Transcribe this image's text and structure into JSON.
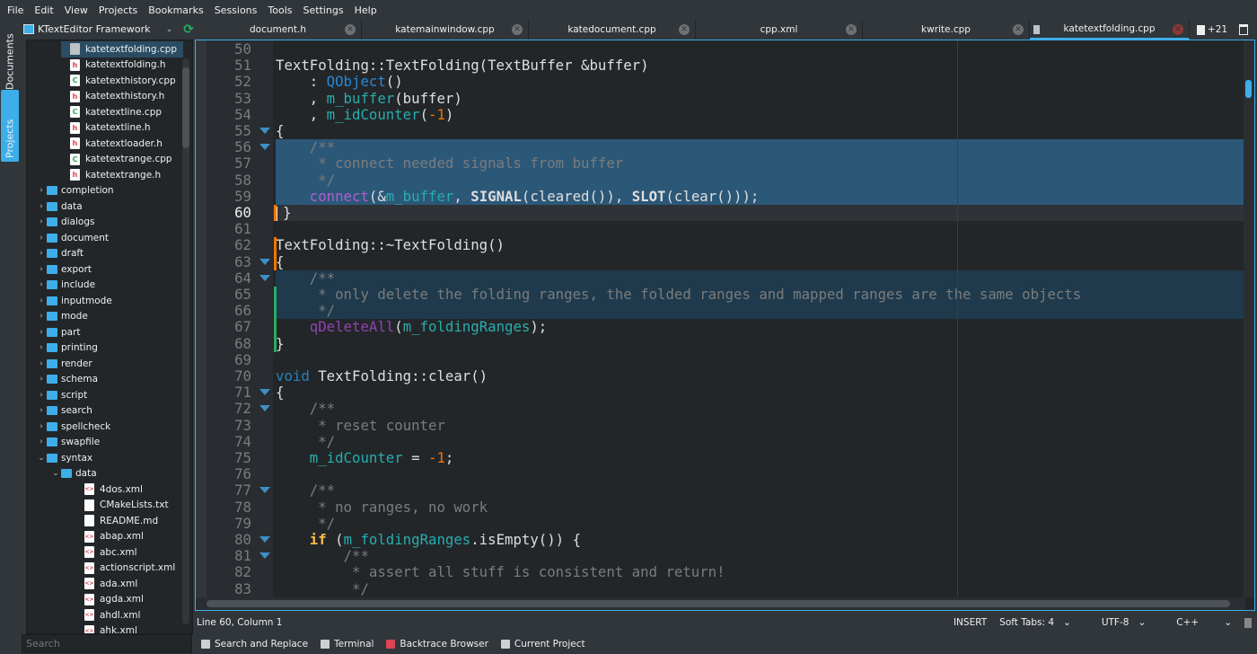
{
  "menu": [
    "File",
    "Edit",
    "View",
    "Projects",
    "Bookmarks",
    "Sessions",
    "Tools",
    "Settings",
    "Help"
  ],
  "left_tabs": {
    "documents": "Documents",
    "projects": "Projects"
  },
  "project": {
    "name": "KTextEditor Framework",
    "refresh_icon": "refresh-icon",
    "dropdown_icon": "chevron-down-icon"
  },
  "tree": [
    {
      "label": "katetextfolding.cpp",
      "type": "cpp-open",
      "level": 3,
      "selected": true
    },
    {
      "label": "katetextfolding.h",
      "type": "h",
      "level": 3
    },
    {
      "label": "katetexthistory.cpp",
      "type": "cpp",
      "level": 3
    },
    {
      "label": "katetexthistory.h",
      "type": "h",
      "level": 3
    },
    {
      "label": "katetextline.cpp",
      "type": "cpp",
      "level": 3
    },
    {
      "label": "katetextline.h",
      "type": "h",
      "level": 3
    },
    {
      "label": "katetextloader.h",
      "type": "h",
      "level": 3
    },
    {
      "label": "katetextrange.cpp",
      "type": "cpp",
      "level": 3
    },
    {
      "label": "katetextrange.h",
      "type": "h",
      "level": 3
    },
    {
      "label": "completion",
      "type": "dir",
      "level": 1
    },
    {
      "label": "data",
      "type": "dir",
      "level": 1
    },
    {
      "label": "dialogs",
      "type": "dir",
      "level": 1
    },
    {
      "label": "document",
      "type": "dir",
      "level": 1
    },
    {
      "label": "draft",
      "type": "dir",
      "level": 1
    },
    {
      "label": "export",
      "type": "dir",
      "level": 1
    },
    {
      "label": "include",
      "type": "dir",
      "level": 1
    },
    {
      "label": "inputmode",
      "type": "dir",
      "level": 1
    },
    {
      "label": "mode",
      "type": "dir",
      "level": 1
    },
    {
      "label": "part",
      "type": "dir",
      "level": 1
    },
    {
      "label": "printing",
      "type": "dir",
      "level": 1
    },
    {
      "label": "render",
      "type": "dir",
      "level": 1
    },
    {
      "label": "schema",
      "type": "dir",
      "level": 1
    },
    {
      "label": "script",
      "type": "dir",
      "level": 1
    },
    {
      "label": "search",
      "type": "dir",
      "level": 1
    },
    {
      "label": "spellcheck",
      "type": "dir",
      "level": 1
    },
    {
      "label": "swapfile",
      "type": "dir",
      "level": 1
    },
    {
      "label": "syntax",
      "type": "dir-open",
      "level": 1
    },
    {
      "label": "data",
      "type": "dir-open",
      "level": 2
    },
    {
      "label": "4dos.xml",
      "type": "xml",
      "level": 4
    },
    {
      "label": "CMakeLists.txt",
      "type": "txt",
      "level": 4
    },
    {
      "label": "README.md",
      "type": "txt",
      "level": 4
    },
    {
      "label": "abap.xml",
      "type": "xml",
      "level": 4
    },
    {
      "label": "abc.xml",
      "type": "xml",
      "level": 4
    },
    {
      "label": "actionscript.xml",
      "type": "xml",
      "level": 4
    },
    {
      "label": "ada.xml",
      "type": "xml",
      "level": 4
    },
    {
      "label": "agda.xml",
      "type": "xml",
      "level": 4
    },
    {
      "label": "ahdl.xml",
      "type": "xml",
      "level": 4
    },
    {
      "label": "ahk.xml",
      "type": "xml",
      "level": 4
    }
  ],
  "search_placeholder": "Search",
  "tabs": [
    {
      "label": "document.h"
    },
    {
      "label": "katemainwindow.cpp"
    },
    {
      "label": "katedocument.cpp"
    },
    {
      "label": "cpp.xml"
    },
    {
      "label": "kwrite.cpp"
    },
    {
      "label": "katetextfolding.cpp",
      "active": true
    }
  ],
  "more_tabs": "+21",
  "editor": {
    "first_line": 50,
    "current_line": 60,
    "selected_lines": [
      56,
      57,
      58,
      59
    ],
    "hover_fold_lines": [
      64,
      65,
      66
    ],
    "fold_markers": [
      55,
      56,
      63,
      64,
      71,
      72,
      77,
      80,
      81
    ],
    "modified_orange": [
      60,
      62,
      63
    ],
    "modified_green": [
      65,
      66,
      67,
      68
    ],
    "lines": [
      [],
      [
        [
          "",
          "TextFolding::TextFolding(TextBuffer &buffer)"
        ]
      ],
      [
        [
          "",
          "    : "
        ],
        [
          "qt",
          "QObject"
        ],
        [
          "",
          "()"
        ]
      ],
      [
        [
          "",
          "    , "
        ],
        [
          "mv",
          "m_buffer"
        ],
        [
          "",
          "(buffer)"
        ]
      ],
      [
        [
          "",
          "    , "
        ],
        [
          "mv",
          "m_idCounter"
        ],
        [
          "",
          "("
        ],
        [
          "nu",
          "-1"
        ],
        [
          "",
          ")"
        ]
      ],
      [
        [
          "",
          "{"
        ]
      ],
      [
        [
          "cm",
          "    /**"
        ]
      ],
      [
        [
          "cm",
          "     * connect needed signals from buffer"
        ]
      ],
      [
        [
          "cm",
          "     */"
        ]
      ],
      [
        [
          "",
          "    "
        ],
        [
          "fb",
          "connect"
        ],
        [
          "",
          "(&"
        ],
        [
          "mv",
          "m_buffer"
        ],
        [
          "",
          ", "
        ],
        [
          "bo",
          "SIGNAL"
        ],
        [
          "",
          "(cleared()), "
        ],
        [
          "bo",
          "SLOT"
        ],
        [
          "",
          "(clear()));"
        ]
      ],
      [
        [
          "",
          ""
        ],
        [
          "",
          "}"
        ]
      ],
      [],
      [
        [
          "",
          "TextFolding::~TextFolding()"
        ]
      ],
      [
        [
          "",
          "{"
        ]
      ],
      [
        [
          "cm",
          "    /**"
        ]
      ],
      [
        [
          "cm",
          "     * only delete the folding ranges, the folded ranges and mapped ranges are the same objects"
        ]
      ],
      [
        [
          "cm",
          "     */"
        ]
      ],
      [
        [
          "",
          "    "
        ],
        [
          "fn",
          "qDeleteAll"
        ],
        [
          "",
          "("
        ],
        [
          "mv",
          "m_foldingRanges"
        ],
        [
          "",
          ");"
        ]
      ],
      [
        [
          "",
          "}"
        ]
      ],
      [],
      [
        [
          "ty",
          "void"
        ],
        [
          "",
          " TextFolding::clear()"
        ]
      ],
      [
        [
          "",
          "{"
        ]
      ],
      [
        [
          "cm",
          "    /**"
        ]
      ],
      [
        [
          "cm",
          "     * reset counter"
        ]
      ],
      [
        [
          "cm",
          "     */"
        ]
      ],
      [
        [
          "",
          "    "
        ],
        [
          "mv",
          "m_idCounter"
        ],
        [
          "",
          " = "
        ],
        [
          "nu",
          "-1"
        ],
        [
          "",
          ";"
        ]
      ],
      [],
      [
        [
          "cm",
          "    /**"
        ]
      ],
      [
        [
          "cm",
          "     * no ranges, no work"
        ]
      ],
      [
        [
          "cm",
          "     */"
        ]
      ],
      [
        [
          "",
          "    "
        ],
        [
          "kw",
          "if"
        ],
        [
          "",
          " ("
        ],
        [
          "mv",
          "m_foldingRanges"
        ],
        [
          "",
          ".isEmpty()) {"
        ]
      ],
      [
        [
          "cm",
          "        /**"
        ]
      ],
      [
        [
          "cm",
          "         * assert all stuff is consistent and return!"
        ]
      ],
      [
        [
          "cm",
          "         */"
        ]
      ]
    ]
  },
  "status": {
    "position": "Line 60, Column 1",
    "mode": "INSERT",
    "indent": "Soft Tabs: 4",
    "encoding": "UTF-8",
    "syntax": "C++"
  },
  "bottom": [
    "Search and Replace",
    "Terminal",
    "Backtrace Browser",
    "Current Project"
  ]
}
